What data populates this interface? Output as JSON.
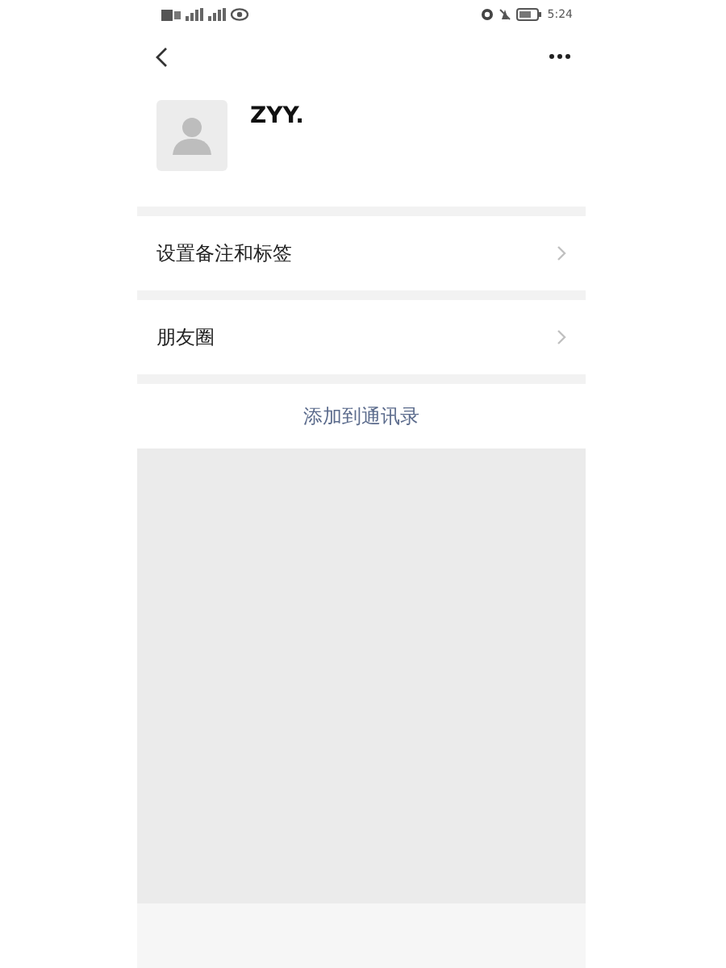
{
  "status_bar": {
    "time": "5:24"
  },
  "profile": {
    "name": "ZYY."
  },
  "menu_items": [
    {
      "label": "设置备注和标签"
    },
    {
      "label": "朋友圈"
    }
  ],
  "action": {
    "label": "添加到通讯录"
  }
}
